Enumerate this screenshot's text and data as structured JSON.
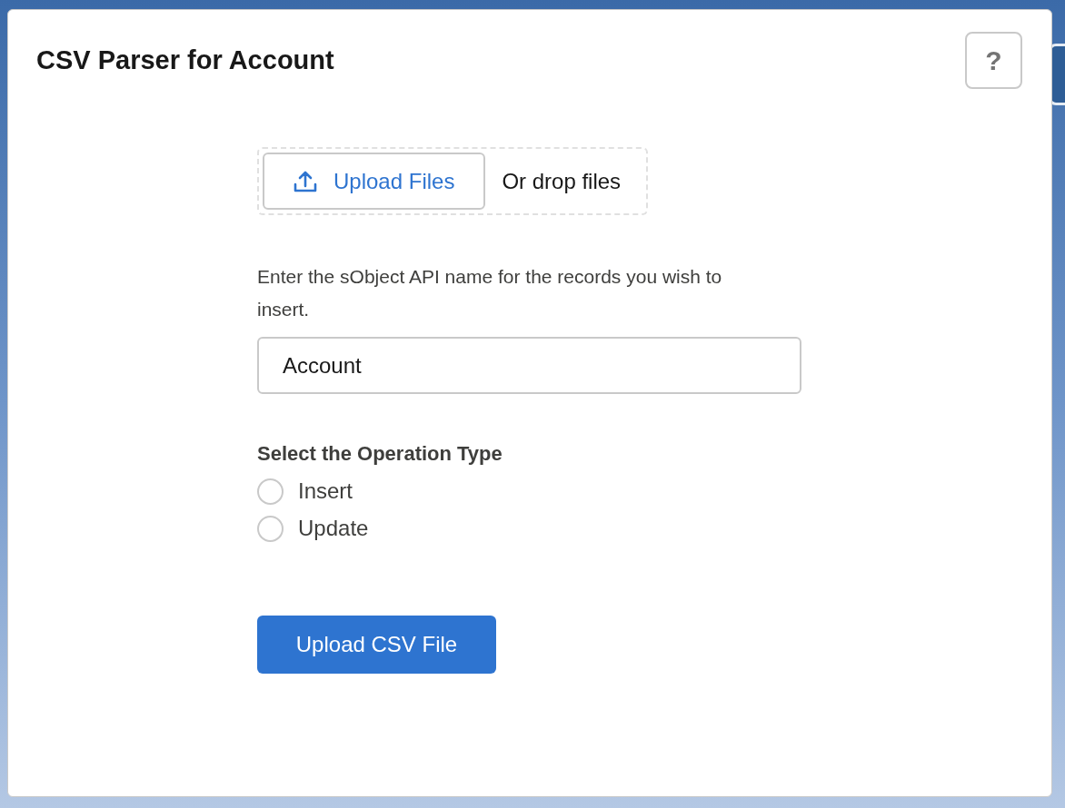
{
  "card": {
    "title": "CSV Parser for Account",
    "help_button": "?"
  },
  "upload": {
    "button": "Upload Files",
    "drop_hint": "Or drop files"
  },
  "sobject": {
    "label": "Enter the sObject API name for the records you wish to insert.",
    "value": "Account"
  },
  "operation": {
    "legend": "Select the Operation Type",
    "options": [
      {
        "label": "Insert",
        "selected": false
      },
      {
        "label": "Update",
        "selected": false
      }
    ]
  },
  "submit_button": "Upload CSV File"
}
